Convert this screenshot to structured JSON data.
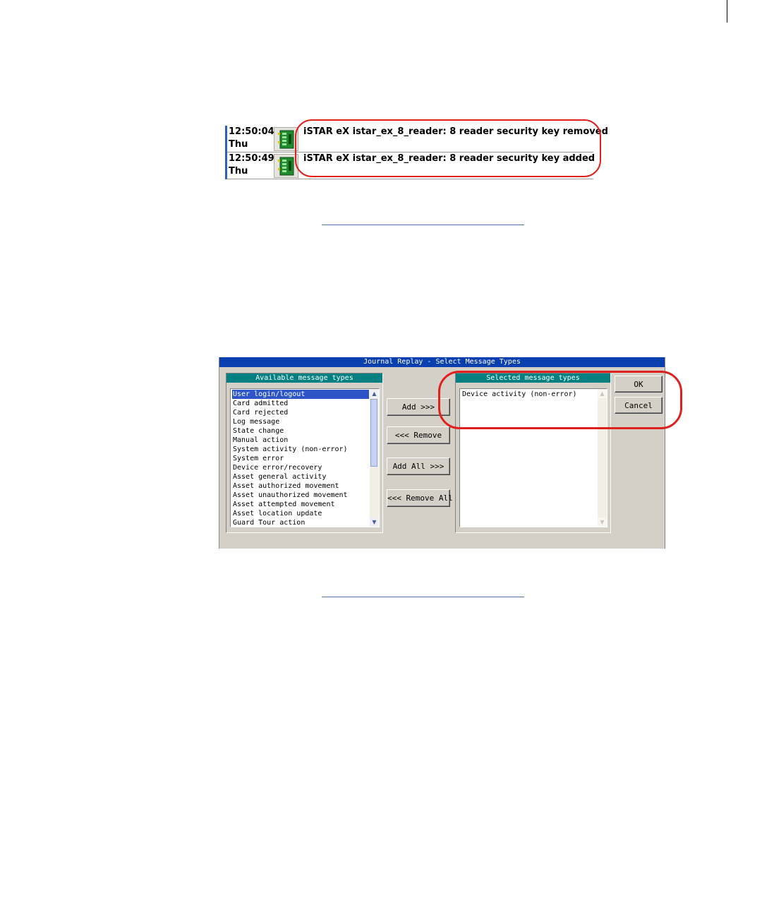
{
  "event_log": {
    "rows": [
      {
        "time": "12:50:04",
        "day": "Thu",
        "icon": "istar-controller-icon",
        "message": "iSTAR eX istar_ex_8_reader: 8 reader security key removed"
      },
      {
        "time": "12:50:49",
        "day": "Thu",
        "icon": "istar-controller-icon",
        "message": "iSTAR eX istar_ex_8_reader: 8 reader security key added"
      }
    ]
  },
  "dialog": {
    "title": "Journal Replay - Select Message Types",
    "available": {
      "header": "Available message types",
      "selected_item": "User login/logout",
      "items": [
        "User login/logout",
        "Card admitted",
        "Card rejected",
        "Log message",
        "State change",
        "Manual action",
        "System activity (non-error)",
        "System error",
        "Device error/recovery",
        "Asset general activity",
        "Asset authorized movement",
        "Asset unauthorized movement",
        "Asset attempted movement",
        "Asset location update",
        "Guard Tour action"
      ]
    },
    "selected": {
      "header": "Selected message types",
      "items": [
        "Device activity (non-error)"
      ]
    },
    "buttons": {
      "add": "Add >>>",
      "remove": "<<< Remove",
      "add_all": "Add All >>>",
      "remove_all": "<<< Remove All",
      "ok": "OK",
      "cancel": "Cancel"
    }
  },
  "colors": {
    "highlight_oval": "#e0201c",
    "title_bar": "#0a3fb0",
    "panel_header": "#008080",
    "selection": "#2d55c8"
  }
}
